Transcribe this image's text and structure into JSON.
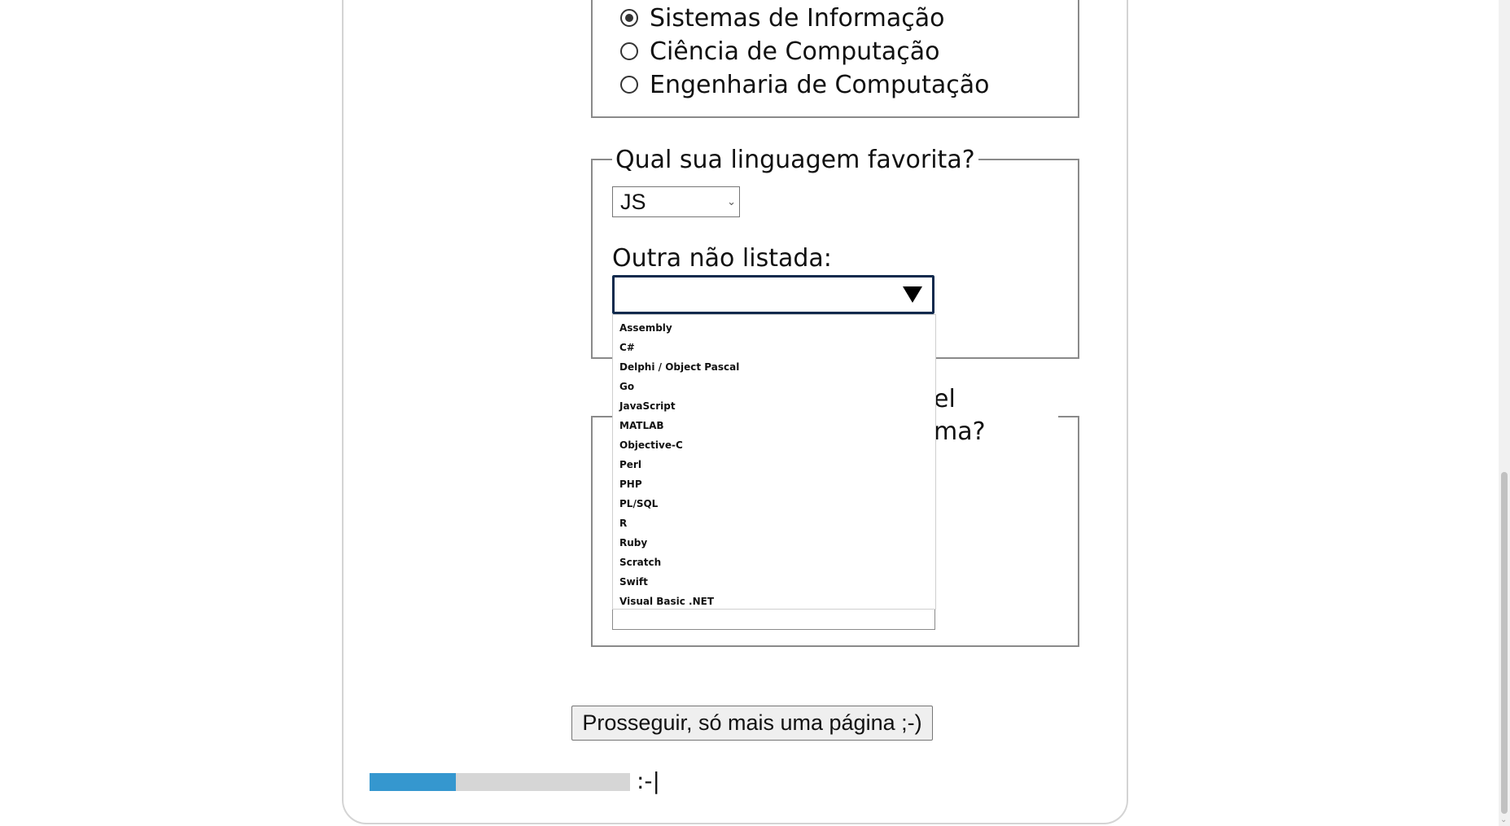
{
  "course_options": [
    {
      "label": "Sistemas de Informação",
      "checked": true
    },
    {
      "label": "Ciência de Computação",
      "checked": false
    },
    {
      "label": "Engenharia de Computação",
      "checked": false
    }
  ],
  "language_section": {
    "legend": "Qual sua linguagem favorita?",
    "selected_language": "JS",
    "other_label": "Outra não listada:",
    "other_value": "",
    "other_options": [
      "Assembly",
      "C#",
      "Delphi / Object Pascal",
      "Go",
      "JavaScript",
      "MATLAB",
      "Objective-C",
      "Perl",
      "PHP",
      "PL/SQL",
      "R",
      "Ruby",
      "Scratch",
      "Swift",
      "Visual Basic .NET"
    ]
  },
  "next_section": {
    "partial_line1": "el",
    "partial_line2": "ma?"
  },
  "next_button_label": "Prosseguir, só mais uma página ;-)",
  "progress": {
    "fraction": 0.33,
    "face": ":-|"
  }
}
